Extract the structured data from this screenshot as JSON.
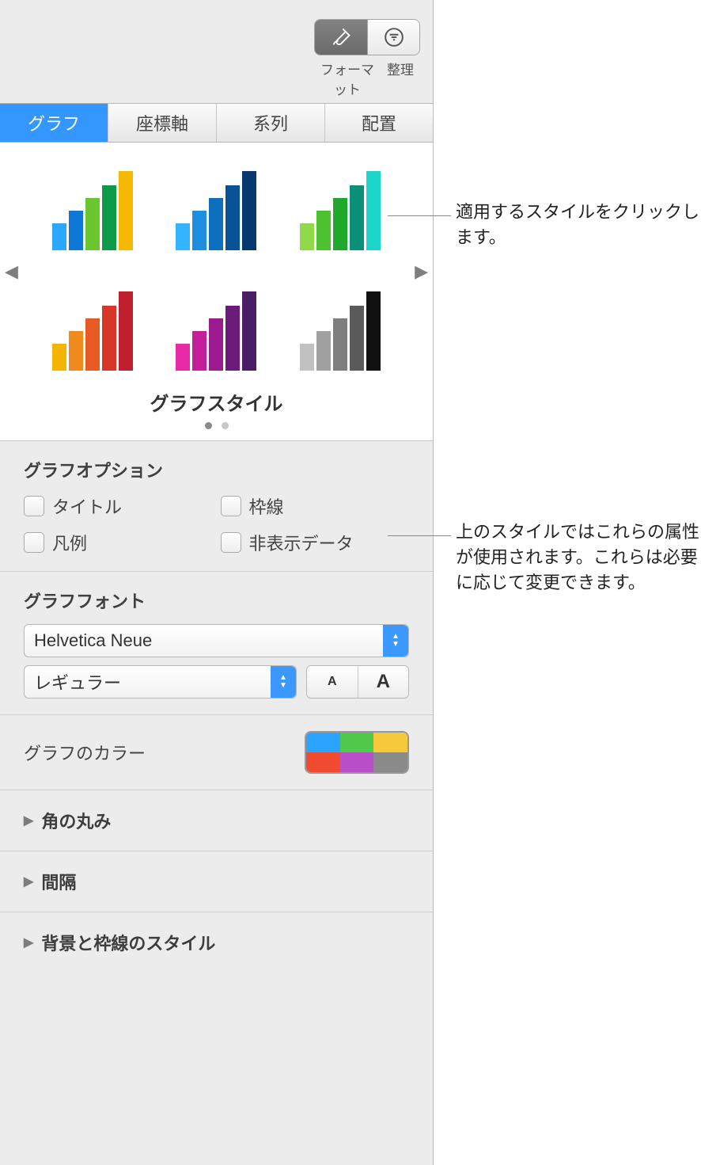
{
  "toolbar": {
    "format_label": "フォーマット",
    "arrange_label": "整理"
  },
  "tabs": {
    "graph": "グラフ",
    "axes": "座標軸",
    "series": "系列",
    "arrange": "配置"
  },
  "styles": {
    "title": "グラフスタイル",
    "thumbs": [
      {
        "colors": [
          "#2aa7ff",
          "#0f77d6",
          "#6ac52f",
          "#0d9b4a",
          "#f5b800"
        ]
      },
      {
        "colors": [
          "#34b4ff",
          "#1e8ee0",
          "#0f6fbf",
          "#0a5297",
          "#063a6e"
        ]
      },
      {
        "colors": [
          "#8fd94a",
          "#4cc230",
          "#1fa82b",
          "#0c8f78",
          "#1bd6c9"
        ]
      },
      {
        "colors": [
          "#f5b400",
          "#f08a1c",
          "#e85a24",
          "#d63728",
          "#bf1f2f"
        ]
      },
      {
        "colors": [
          "#e82aa7",
          "#c41e9c",
          "#9a1b8f",
          "#6d1b7a",
          "#4a1e66"
        ]
      },
      {
        "colors": [
          "#c1c1c1",
          "#a0a0a0",
          "#7e7e7e",
          "#5a5a5a",
          "#111111"
        ]
      }
    ]
  },
  "options": {
    "section_title": "グラフオプション",
    "title": "タイトル",
    "border": "枠線",
    "legend": "凡例",
    "hidden_data": "非表示データ"
  },
  "font": {
    "section_title": "グラフフォント",
    "family": "Helvetica Neue",
    "weight": "レギュラー"
  },
  "color": {
    "label": "グラフのカラー",
    "swatches": [
      "#2aa4ff",
      "#4fc84b",
      "#f5c93a",
      "#f04a2f",
      "#b94ec9",
      "#8a8a8a"
    ]
  },
  "accordions": {
    "corner": "角の丸み",
    "spacing": "間隔",
    "background": "背景と枠線のスタイル"
  },
  "callouts": {
    "styles": "適用するスタイルをクリックします。",
    "options": "上のスタイルではこれらの属性が使用されます。これらは必要に応じて変更できます。"
  }
}
